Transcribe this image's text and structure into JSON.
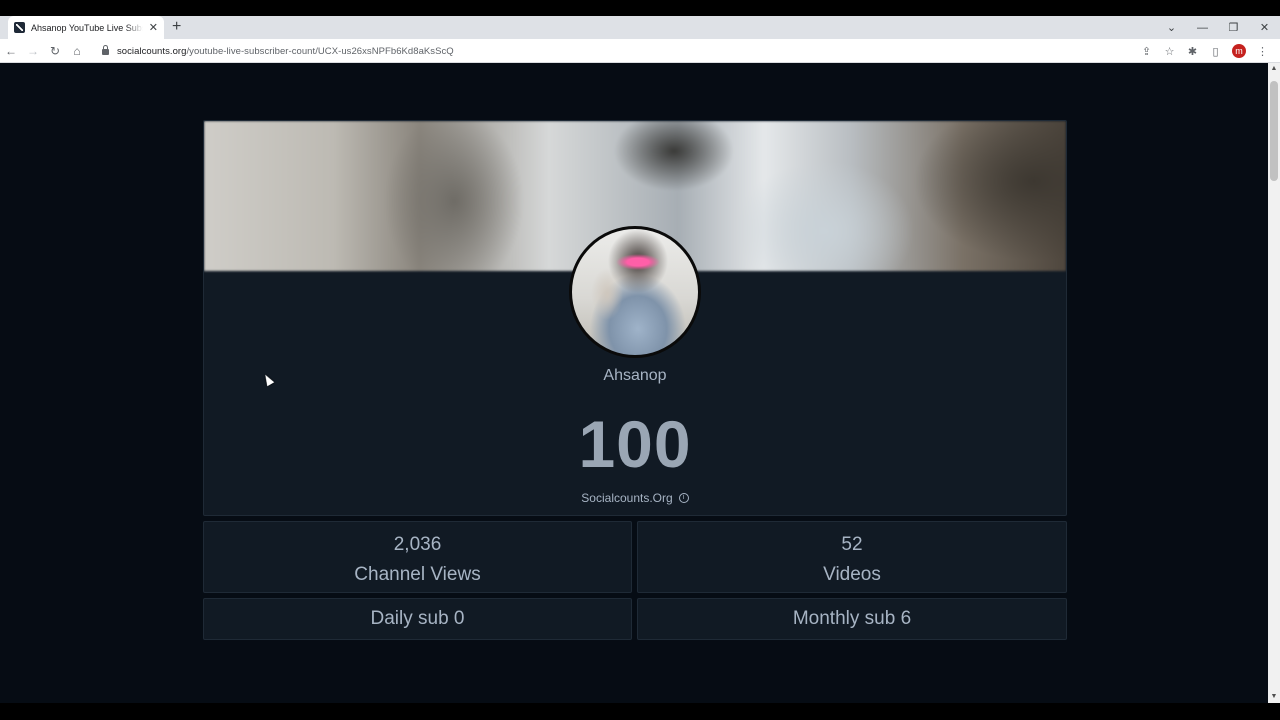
{
  "browser": {
    "tab_title": "Ahsanop YouTube Live Subscriber Count",
    "url_domain": "socialcounts.org",
    "url_path": "/youtube-live-subscriber-count/UCX-us26xsNPFb6Kd8aKsScQ",
    "profile_initial": "m"
  },
  "channel": {
    "name": "Ahsanop",
    "subscriber_count": "100",
    "source_label": "Socialcounts.Org"
  },
  "stats": {
    "views_value": "2,036",
    "views_label": "Channel Views",
    "videos_value": "52",
    "videos_label": "Videos",
    "daily_sub": "Daily sub 0",
    "monthly_sub": "Monthly sub 6"
  },
  "colors": {
    "page_background": "#060c14",
    "card_background": "#111a24",
    "text": "#a7b4c4"
  }
}
